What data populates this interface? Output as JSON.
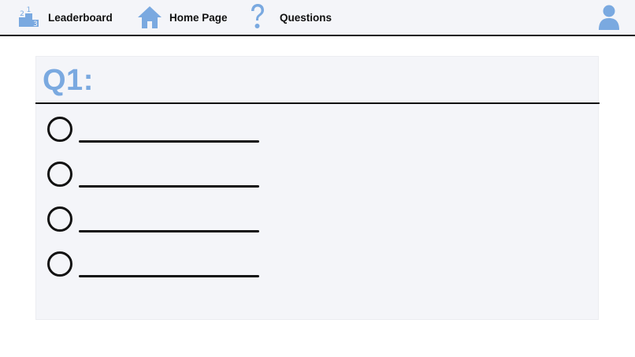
{
  "nav": {
    "leaderboard_label": "Leaderboard",
    "home_label": "Home Page",
    "questions_label": "Questions"
  },
  "icons": {
    "leaderboard": "podium-icon",
    "home": "home-icon",
    "questions": "question-mark-icon",
    "user": "user-icon"
  },
  "podium_digits": [
    "2",
    "1",
    "3"
  ],
  "question": {
    "title": "Q1:",
    "options": [
      "",
      "",
      "",
      ""
    ]
  },
  "colors": {
    "accent": "#7aa9e0",
    "bar_background": "#f4f5f9",
    "card_background": "#f4f5f9",
    "rule": "#111111"
  }
}
